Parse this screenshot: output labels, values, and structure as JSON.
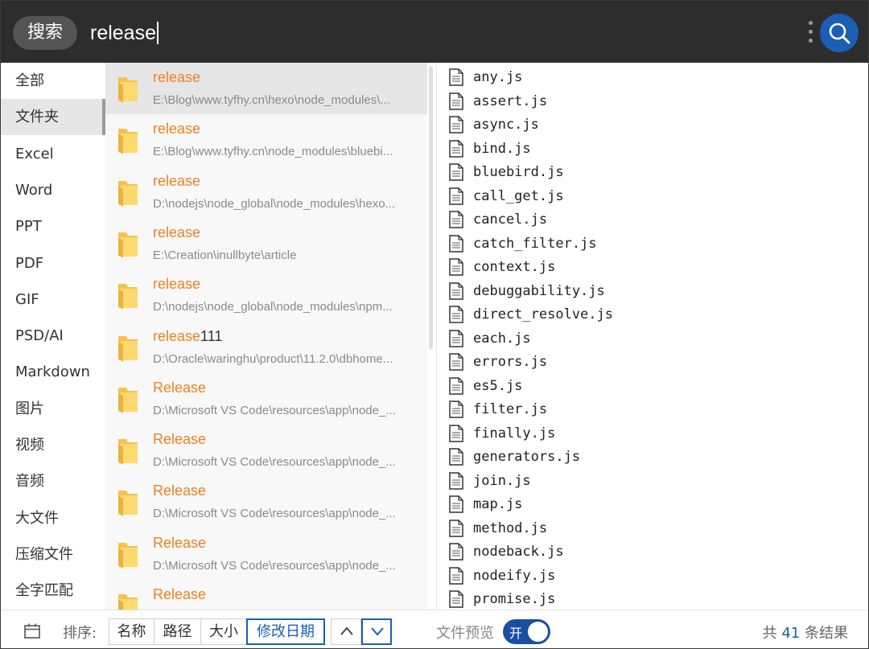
{
  "header": {
    "search_label": "搜索",
    "query": "release",
    "more_icon": "more-vertical-icon",
    "search_icon": "search-icon"
  },
  "sidebar": {
    "items": [
      {
        "label": "全部",
        "active": false
      },
      {
        "label": "文件夹",
        "active": true
      },
      {
        "label": "Excel",
        "active": false
      },
      {
        "label": "Word",
        "active": false
      },
      {
        "label": "PPT",
        "active": false
      },
      {
        "label": "PDF",
        "active": false
      },
      {
        "label": "GIF",
        "active": false
      },
      {
        "label": "PSD/AI",
        "active": false
      },
      {
        "label": "Markdown",
        "active": false
      },
      {
        "label": "图片",
        "active": false
      },
      {
        "label": "视频",
        "active": false
      },
      {
        "label": "音频",
        "active": false
      },
      {
        "label": "大文件",
        "active": false
      },
      {
        "label": "压缩文件",
        "active": false
      },
      {
        "label": "全字匹配",
        "active": false
      }
    ]
  },
  "results": [
    {
      "match": "release",
      "rest": "",
      "path": "E:\\Blog\\www.tyfhy.cn\\hexo\\node_modules\\...",
      "selected": true
    },
    {
      "match": "release",
      "rest": "",
      "path": "E:\\Blog\\www.tyfhy.cn\\node_modules\\bluebi...",
      "selected": false
    },
    {
      "match": "release",
      "rest": "",
      "path": "D:\\nodejs\\node_global\\node_modules\\hexo...",
      "selected": false
    },
    {
      "match": "release",
      "rest": "",
      "path": "E:\\Creation\\inullbyte\\article",
      "selected": false
    },
    {
      "match": "release",
      "rest": "",
      "path": "D:\\nodejs\\node_global\\node_modules\\npm...",
      "selected": false
    },
    {
      "match": "release",
      "rest": "111",
      "path": "D:\\Oracle\\waringhu\\product\\11.2.0\\dbhome...",
      "selected": false
    },
    {
      "match": "Release",
      "rest": "",
      "path": "D:\\Microsoft VS Code\\resources\\app\\node_...",
      "selected": false
    },
    {
      "match": "Release",
      "rest": "",
      "path": "D:\\Microsoft VS Code\\resources\\app\\node_...",
      "selected": false
    },
    {
      "match": "Release",
      "rest": "",
      "path": "D:\\Microsoft VS Code\\resources\\app\\node_...",
      "selected": false
    },
    {
      "match": "Release",
      "rest": "",
      "path": "D:\\Microsoft VS Code\\resources\\app\\node_...",
      "selected": false
    },
    {
      "match": "Release",
      "rest": "",
      "path": "",
      "selected": false
    }
  ],
  "preview": {
    "files": [
      "any.js",
      "assert.js",
      "async.js",
      "bind.js",
      "bluebird.js",
      "call_get.js",
      "cancel.js",
      "catch_filter.js",
      "context.js",
      "debuggability.js",
      "direct_resolve.js",
      "each.js",
      "errors.js",
      "es5.js",
      "filter.js",
      "finally.js",
      "generators.js",
      "join.js",
      "map.js",
      "method.js",
      "nodeback.js",
      "nodeify.js",
      "promise.js"
    ],
    "file_icon": "file-icon"
  },
  "footer": {
    "calendar_icon": "calendar-icon",
    "sort_label": "排序:",
    "sort_options": [
      {
        "label": "名称",
        "active": false
      },
      {
        "label": "路径",
        "active": false
      },
      {
        "label": "大小",
        "active": false
      },
      {
        "label": "修改日期",
        "active": true
      }
    ],
    "sort_asc_icon": "chevron-up-icon",
    "sort_desc_icon": "chevron-down-icon",
    "sort_direction": "desc",
    "preview_label": "文件预览",
    "preview_toggle": "开",
    "preview_enabled": true,
    "count_prefix": "共",
    "count_value": "41",
    "count_suffix": "条结果"
  },
  "colors": {
    "header_bg": "#2d2d2d",
    "accent": "#1a5fb4",
    "match_highlight": "#f08020"
  }
}
